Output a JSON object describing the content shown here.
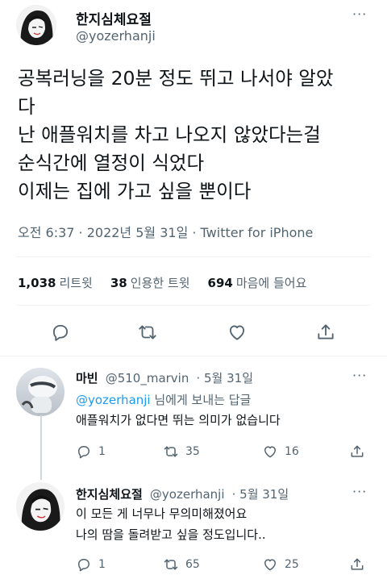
{
  "tweet": {
    "author_name": "한지심체요절",
    "author_handle": "@yozerhanji",
    "more_label": "···",
    "text_lines": [
      "공복러닝을 20분 정도 뛰고 나서야 알았",
      "다",
      "난 애플워치를 차고 나오지 않았다는걸",
      "순식간에 열정이 식었다",
      "이제는 집에 가고 싶을 뿐이다"
    ],
    "meta": "오전 6:37 · 2022년 5월 31일 · Twitter for iPhone",
    "stats": {
      "retweets_count": "1,038",
      "retweets_label": "리트윗",
      "quotes_count": "38",
      "quotes_label": "인용한 트윗",
      "likes_count": "694",
      "likes_label": "마음에 들어요"
    },
    "actions": [
      "reply-icon",
      "retweet-icon",
      "like-icon",
      "share-icon"
    ]
  },
  "replies": [
    {
      "name": "마빈",
      "handle": "@510_marvin",
      "date": "· 5월 31일",
      "more_label": "···",
      "reply_to_mention": "@yozerhanji",
      "reply_to_suffix": " 님에게 보내는 답글",
      "text_lines": [
        "애플워치가 없다면 뛰는 의미가 없습니다"
      ],
      "reply_count": "1",
      "retweet_count": "35",
      "like_count": "16"
    },
    {
      "name": "한지심체요절",
      "handle": "@yozerhanji",
      "date": "· 5월 31일",
      "more_label": "···",
      "text_lines": [
        "이 모든 게 너무나 무의미해졌어요",
        "나의 땀을 돌려받고 싶을 정도입니다.."
      ],
      "reply_count": "1",
      "retweet_count": "65",
      "like_count": "25"
    }
  ],
  "colors": {
    "text": "#0f1419",
    "secondary": "#536471",
    "accent": "#1d9bf0",
    "divider": "#eff3f4"
  }
}
